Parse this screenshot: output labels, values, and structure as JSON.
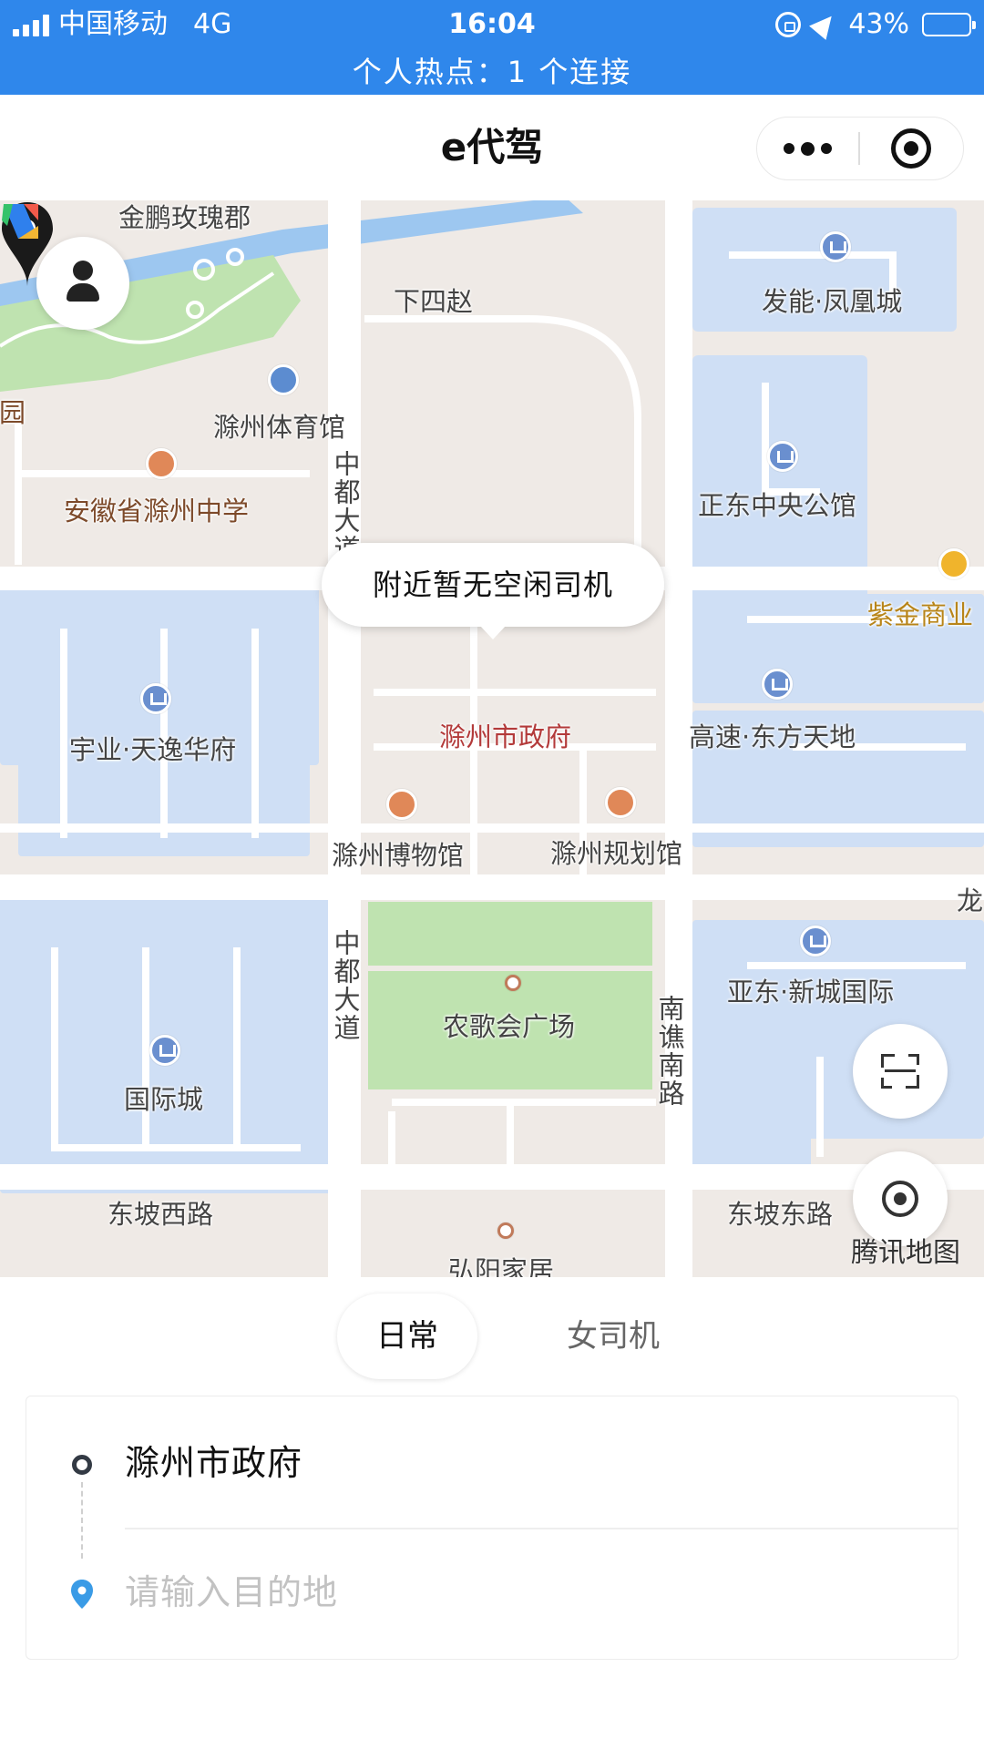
{
  "status_bar": {
    "carrier": "中国移动",
    "network": "4G",
    "time": "16:04",
    "battery_percent_text": "43%",
    "battery_level": 0.43,
    "hotspot_text": "个人热点：1 个连接"
  },
  "header": {
    "title": "e代驾",
    "more_icon": "more-dots-icon",
    "close_icon": "close-miniprogram-icon"
  },
  "map": {
    "labels": {
      "jinpeng": "金鹏玫瑰郡",
      "xiasizhao": "下四赵",
      "faneng": "发能·凤凰城",
      "park": "公园",
      "stadium": "滁州体育馆",
      "school": "安徽省滁州中学",
      "zhongdu_n": "中都大道",
      "zhengdong": "正东中央公馆",
      "zijin": "紫金商业",
      "yuye": "宇业·天逸华府",
      "gov": "滁州市政府",
      "gaosu": "高速·东方天地",
      "museum": "滁州博物馆",
      "planning": "滁州规划馆",
      "long": "龙",
      "zhongdu_s": "中都大道",
      "nongge": "农歌会广场",
      "yadong": "亚东·新城国际",
      "nanqiao": "南谯南路",
      "guojicheng": "国际城",
      "dongpo_w": "东坡西路",
      "dongpo_e": "东坡东路",
      "hongyang": "弘阳家居"
    },
    "bubble_text": "附近暂无空闲司机",
    "attribution": "腾讯地图"
  },
  "tabs": {
    "daily": "日常",
    "female_driver": "女司机",
    "selected": "日常"
  },
  "route": {
    "origin": "滁州市政府",
    "destination_value": "",
    "destination_placeholder": "请输入目的地"
  },
  "colors": {
    "status_bar_bg": "#2f87eb",
    "map_bg": "#efeae6",
    "block_blue": "#cfdff5",
    "park_green": "#bfe3b0",
    "water": "#9dc7f0"
  }
}
